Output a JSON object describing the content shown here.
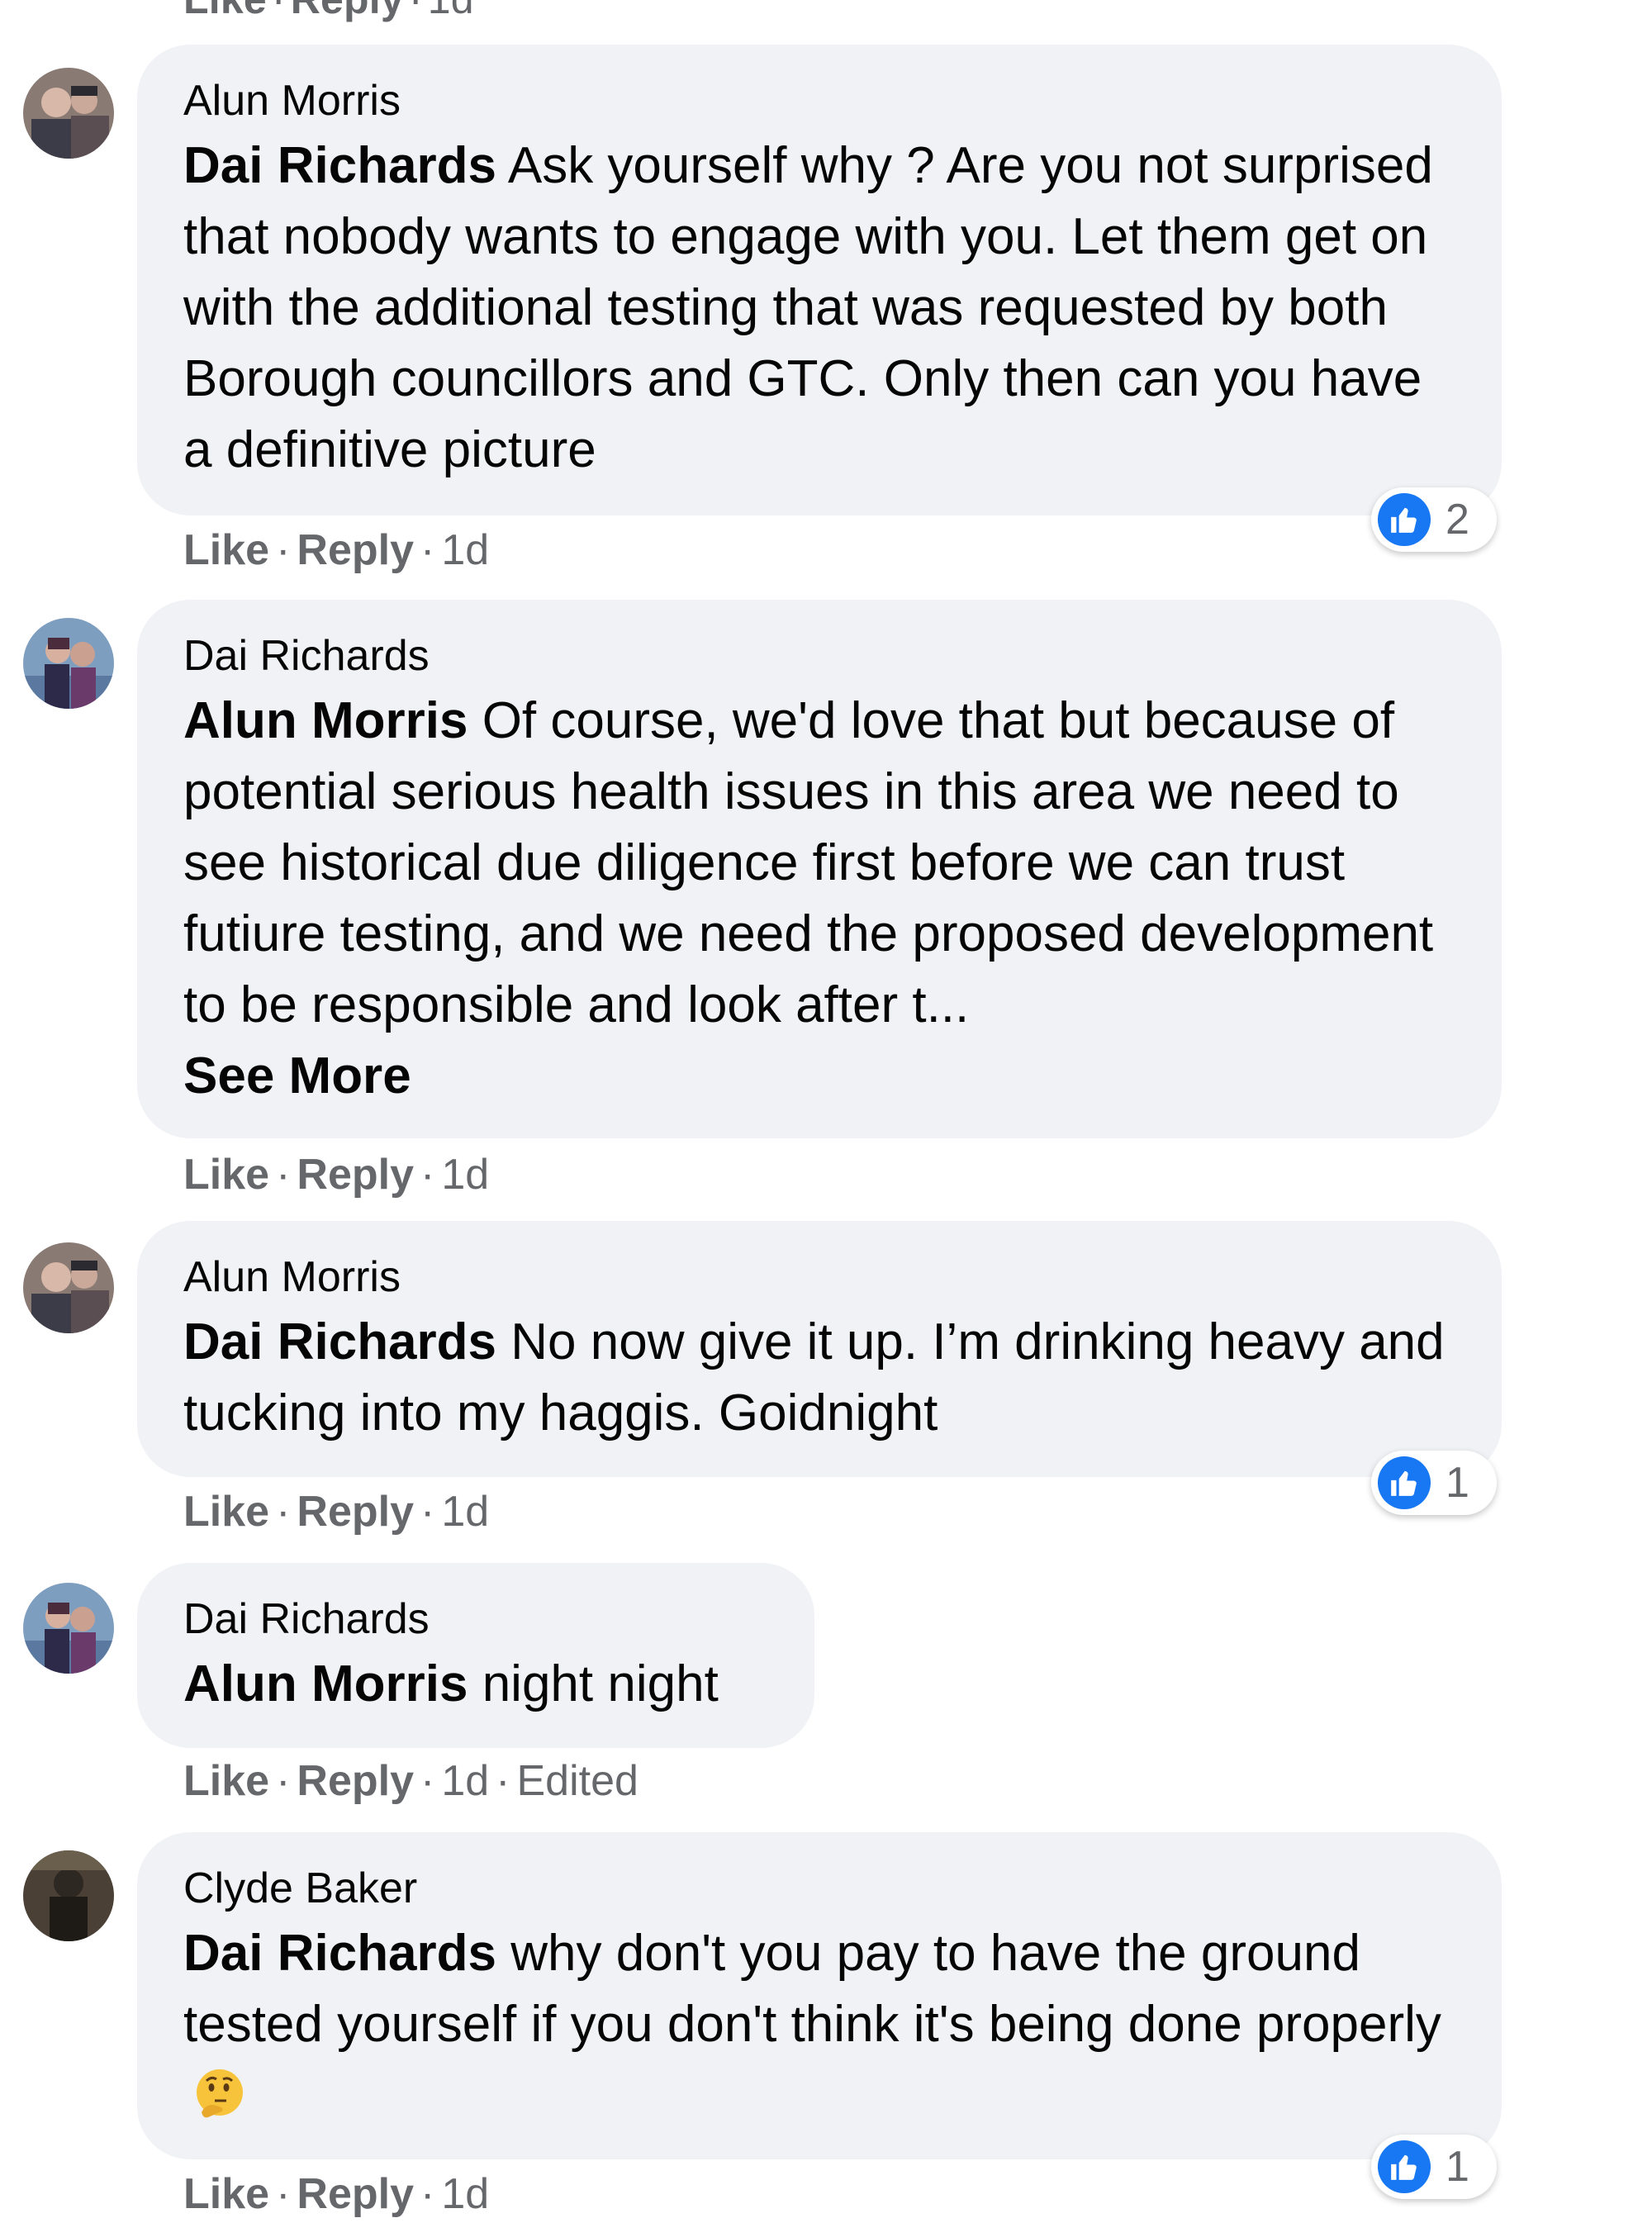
{
  "colors": {
    "bubble": "#f0f2f5",
    "like_blue": "#1877f2",
    "meta_gray": "#65676b",
    "text": "#050505"
  },
  "top_actions": {
    "like": "Like",
    "reply": "Reply",
    "time": "1d"
  },
  "comments": [
    {
      "author": "Alun Morris",
      "mention": "Dai Richards",
      "text": "Ask yourself why ? Are you not surprised that nobody wants to engage with you. Let them get on with the additional testing that was requested by both Borough councillors and GTC. Only then can you have a definitive picture",
      "like": "Like",
      "reply": "Reply",
      "time": "1d",
      "reaction_count": "2",
      "avatar_icon": "profile-photo-icon"
    },
    {
      "author": "Dai Richards",
      "mention": "Alun Morris",
      "text": "Of course, we'd love that but because of potential serious health issues in this area we need to see historical due diligence first before we can trust futiure testing, and we need the proposed development to be responsible and look after t...",
      "see_more": "See More",
      "like": "Like",
      "reply": "Reply",
      "time": "1d",
      "avatar_icon": "profile-photo-icon"
    },
    {
      "author": "Alun Morris",
      "mention": "Dai Richards",
      "text": "No now give it up. I’m drinking heavy and tucking into my haggis. Goidnight",
      "like": "Like",
      "reply": "Reply",
      "time": "1d",
      "reaction_count": "1",
      "avatar_icon": "profile-photo-icon"
    },
    {
      "author": "Dai Richards",
      "mention": "Alun Morris",
      "text": "night night",
      "like": "Like",
      "reply": "Reply",
      "time": "1d",
      "edited": "Edited",
      "avatar_icon": "profile-photo-icon"
    },
    {
      "author": "Clyde Baker",
      "mention": "Dai Richards",
      "text": "why don't you pay to have the ground tested yourself if you don't think it's being done properly",
      "emoji_icon": "thinking-face-icon",
      "like": "Like",
      "reply": "Reply",
      "time": "1d",
      "reaction_count": "1",
      "avatar_icon": "profile-photo-icon"
    }
  ]
}
